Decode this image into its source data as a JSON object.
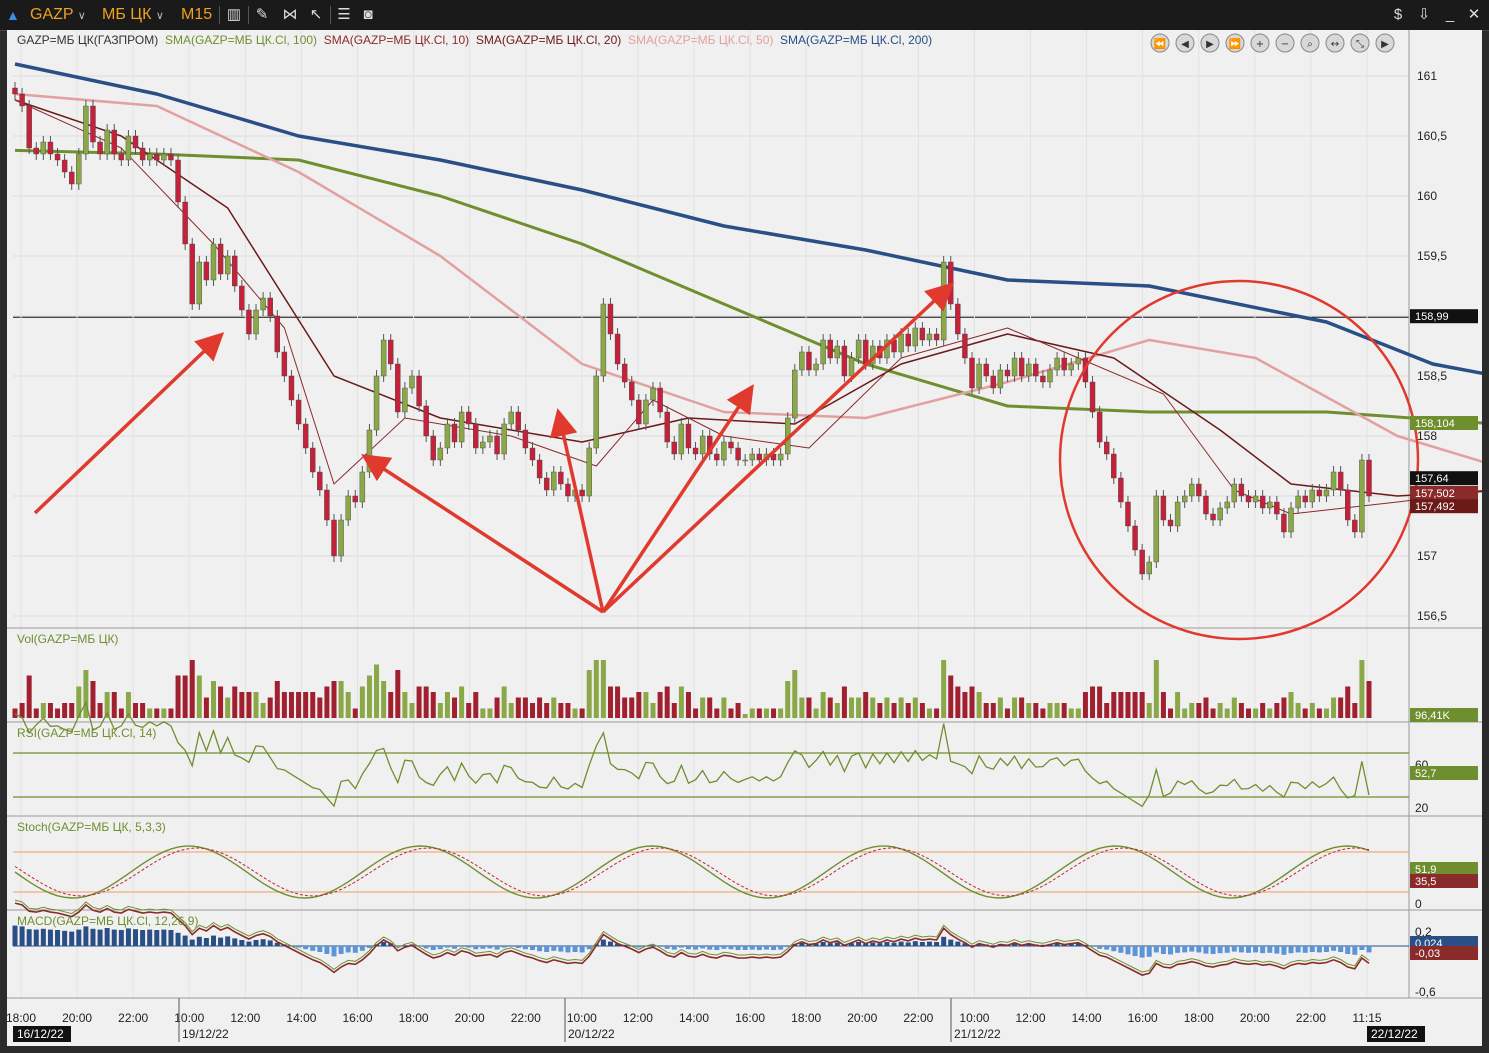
{
  "toolbar": {
    "symbol": "GAZP",
    "board": "МБ ЦК",
    "timeframe": "M15"
  },
  "panes": {
    "price": {
      "legend": [
        {
          "text": "GAZP=МБ ЦК(ГАЗПРОМ)",
          "color": "#333333"
        },
        {
          "text": "SMA(GAZP=МБ ЦК.Cl, 100)",
          "color": "#6f8f2f"
        },
        {
          "text": "SMA(GAZP=МБ ЦК.Cl, 10)",
          "color": "#8b2a2a"
        },
        {
          "text": "SMA(GAZP=МБ ЦК.Cl, 20)",
          "color": "#6b1a1a"
        },
        {
          "text": "SMA(GAZP=МБ ЦК.Cl, 50)",
          "color": "#e3a0a0"
        },
        {
          "text": "SMA(GAZP=МБ ЦК.Cl, 200)",
          "color": "#2a4f86"
        }
      ],
      "y_ticks": [
        "161",
        "160,5",
        "160",
        "159,5",
        "159",
        "158,5",
        "158",
        "157,5",
        "157",
        "156,5"
      ],
      "price_labels": [
        {
          "text": "158,99",
          "bg": "#111111"
        },
        {
          "text": "158,104",
          "bg": "#6f8f2f"
        },
        {
          "text": "157,64",
          "bg": "#111111"
        },
        {
          "text": "157,502",
          "bg": "#8b2a2a"
        },
        {
          "text": "157,492",
          "bg": "#6b1a1a"
        }
      ]
    },
    "volume": {
      "legend": "Vol(GAZP=МБ ЦК)",
      "value_label": "96,41K"
    },
    "rsi": {
      "legend": "RSI(GAZP=МБ ЦК.Cl, 14)",
      "ticks": [
        "60",
        "20"
      ],
      "value_label": "52,7"
    },
    "stoch": {
      "legend": "Stoch(GAZP=МБ ЦК, 5,3,3)",
      "ticks": [
        "0"
      ],
      "value_labels": [
        "51,9",
        "35,5"
      ]
    },
    "macd": {
      "legend": "MACD(GAZP=МБ ЦК.Cl, 12,26,9)",
      "ticks": [
        "0,2",
        "-0,6"
      ],
      "value_labels": [
        "0,024",
        "-0,03"
      ]
    }
  },
  "time_axis": {
    "labels": [
      "18:00",
      "20:00",
      "22:00",
      "10:00",
      "12:00",
      "14:00",
      "16:00",
      "18:00",
      "20:00",
      "22:00",
      "10:00",
      "12:00",
      "14:00",
      "16:00",
      "18:00",
      "20:00",
      "22:00",
      "10:00",
      "12:00",
      "14:00",
      "16:00",
      "18:00",
      "20:00",
      "22:00",
      "11:15"
    ],
    "dates": [
      "16/12/22",
      "19/12/22",
      "20/12/22",
      "21/12/22",
      "22/12/22"
    ]
  },
  "chart_data": {
    "type": "candlestick",
    "symbol": "GAZP",
    "timeframe": "M15",
    "ylim": [
      156.4,
      161.3
    ],
    "grid": true,
    "legend_position": "top-left",
    "candles": [
      [
        160.9,
        160.85
      ],
      [
        160.85,
        160.75
      ],
      [
        160.75,
        160.4
      ],
      [
        160.4,
        160.35
      ],
      [
        160.35,
        160.45
      ],
      [
        160.45,
        160.35
      ],
      [
        160.35,
        160.3
      ],
      [
        160.3,
        160.2
      ],
      [
        160.2,
        160.1
      ],
      [
        160.1,
        160.35
      ],
      [
        160.35,
        160.75
      ],
      [
        160.75,
        160.45
      ],
      [
        160.45,
        160.35
      ],
      [
        160.35,
        160.55
      ],
      [
        160.55,
        160.35
      ],
      [
        160.35,
        160.3
      ],
      [
        160.3,
        160.5
      ],
      [
        160.5,
        160.4
      ],
      [
        160.4,
        160.3
      ],
      [
        160.3,
        160.35
      ],
      [
        160.35,
        160.3
      ],
      [
        160.3,
        160.35
      ],
      [
        160.35,
        160.3
      ],
      [
        160.3,
        159.95
      ],
      [
        159.95,
        159.6
      ],
      [
        159.6,
        159.1
      ],
      [
        159.1,
        159.45
      ],
      [
        159.45,
        159.3
      ],
      [
        159.3,
        159.6
      ],
      [
        159.6,
        159.35
      ],
      [
        159.35,
        159.5
      ],
      [
        159.5,
        159.25
      ],
      [
        159.25,
        159.05
      ],
      [
        159.05,
        158.85
      ],
      [
        158.85,
        159.05
      ],
      [
        159.05,
        159.15
      ],
      [
        159.15,
        159.0
      ],
      [
        159.0,
        158.7
      ],
      [
        158.7,
        158.5
      ],
      [
        158.5,
        158.3
      ],
      [
        158.3,
        158.1
      ],
      [
        158.1,
        157.9
      ],
      [
        157.9,
        157.7
      ],
      [
        157.7,
        157.55
      ],
      [
        157.55,
        157.3
      ],
      [
        157.3,
        157.0
      ],
      [
        157.0,
        157.3
      ],
      [
        157.3,
        157.5
      ],
      [
        157.5,
        157.45
      ],
      [
        157.45,
        157.7
      ],
      [
        157.7,
        158.05
      ],
      [
        158.05,
        158.5
      ],
      [
        158.5,
        158.8
      ],
      [
        158.8,
        158.6
      ],
      [
        158.6,
        158.2
      ],
      [
        158.2,
        158.4
      ],
      [
        158.4,
        158.5
      ],
      [
        158.5,
        158.25
      ],
      [
        158.25,
        158.0
      ],
      [
        158.0,
        157.8
      ],
      [
        157.8,
        157.9
      ],
      [
        157.9,
        158.1
      ],
      [
        158.1,
        157.95
      ],
      [
        157.95,
        158.2
      ],
      [
        158.2,
        158.1
      ],
      [
        158.1,
        157.9
      ],
      [
        157.9,
        157.95
      ],
      [
        157.95,
        158.0
      ],
      [
        158.0,
        157.85
      ],
      [
        157.85,
        158.1
      ],
      [
        158.1,
        158.2
      ],
      [
        158.2,
        158.05
      ],
      [
        158.05,
        157.9
      ],
      [
        157.9,
        157.8
      ],
      [
        157.8,
        157.65
      ],
      [
        157.65,
        157.55
      ],
      [
        157.55,
        157.7
      ],
      [
        157.7,
        157.6
      ],
      [
        157.6,
        157.5
      ],
      [
        157.5,
        157.55
      ],
      [
        157.55,
        157.5
      ],
      [
        157.5,
        157.9
      ],
      [
        157.9,
        158.5
      ],
      [
        158.5,
        159.1
      ],
      [
        159.1,
        158.85
      ],
      [
        158.85,
        158.6
      ],
      [
        158.6,
        158.45
      ],
      [
        158.45,
        158.3
      ],
      [
        158.3,
        158.1
      ],
      [
        158.1,
        158.3
      ],
      [
        158.3,
        158.4
      ],
      [
        158.4,
        158.2
      ],
      [
        158.2,
        157.95
      ],
      [
        157.95,
        157.85
      ],
      [
        157.85,
        158.1
      ],
      [
        158.1,
        157.9
      ],
      [
        157.9,
        157.85
      ],
      [
        157.85,
        158.0
      ],
      [
        158.0,
        157.85
      ],
      [
        157.85,
        157.8
      ],
      [
        157.8,
        157.95
      ],
      [
        157.95,
        157.9
      ],
      [
        157.9,
        157.8
      ],
      [
        157.8,
        157.8
      ],
      [
        157.8,
        157.85
      ],
      [
        157.85,
        157.8
      ],
      [
        157.8,
        157.85
      ],
      [
        157.85,
        157.8
      ],
      [
        157.8,
        157.85
      ],
      [
        157.85,
        158.15
      ],
      [
        158.15,
        158.55
      ],
      [
        158.55,
        158.7
      ],
      [
        158.7,
        158.55
      ],
      [
        158.55,
        158.6
      ],
      [
        158.6,
        158.8
      ],
      [
        158.8,
        158.65
      ],
      [
        158.65,
        158.75
      ],
      [
        158.75,
        158.5
      ],
      [
        158.5,
        158.65
      ],
      [
        158.65,
        158.8
      ],
      [
        158.8,
        158.6
      ],
      [
        158.6,
        158.75
      ],
      [
        158.75,
        158.65
      ],
      [
        158.65,
        158.8
      ],
      [
        158.8,
        158.7
      ],
      [
        158.7,
        158.85
      ],
      [
        158.85,
        158.75
      ],
      [
        158.75,
        158.9
      ],
      [
        158.9,
        158.8
      ],
      [
        158.8,
        158.85
      ],
      [
        158.85,
        158.8
      ],
      [
        158.8,
        159.45
      ],
      [
        159.45,
        159.1
      ],
      [
        159.1,
        158.85
      ],
      [
        158.85,
        158.65
      ],
      [
        158.65,
        158.4
      ],
      [
        158.4,
        158.6
      ],
      [
        158.6,
        158.5
      ],
      [
        158.5,
        158.4
      ],
      [
        158.4,
        158.55
      ],
      [
        158.55,
        158.5
      ],
      [
        158.5,
        158.65
      ],
      [
        158.65,
        158.5
      ],
      [
        158.5,
        158.6
      ],
      [
        158.6,
        158.5
      ],
      [
        158.5,
        158.45
      ],
      [
        158.45,
        158.55
      ],
      [
        158.55,
        158.65
      ],
      [
        158.65,
        158.55
      ],
      [
        158.55,
        158.6
      ],
      [
        158.6,
        158.65
      ],
      [
        158.65,
        158.45
      ],
      [
        158.45,
        158.2
      ],
      [
        158.2,
        157.95
      ],
      [
        157.95,
        157.85
      ],
      [
        157.85,
        157.65
      ],
      [
        157.65,
        157.45
      ],
      [
        157.45,
        157.25
      ],
      [
        157.25,
        157.05
      ],
      [
        157.05,
        156.85
      ],
      [
        156.85,
        156.95
      ],
      [
        156.95,
        157.5
      ],
      [
        157.5,
        157.3
      ],
      [
        157.3,
        157.25
      ],
      [
        157.25,
        157.45
      ],
      [
        157.45,
        157.5
      ],
      [
        157.5,
        157.6
      ],
      [
        157.6,
        157.5
      ],
      [
        157.5,
        157.35
      ],
      [
        157.35,
        157.3
      ],
      [
        157.3,
        157.4
      ],
      [
        157.4,
        157.45
      ],
      [
        157.45,
        157.6
      ],
      [
        157.6,
        157.5
      ],
      [
        157.5,
        157.45
      ],
      [
        157.45,
        157.5
      ],
      [
        157.5,
        157.4
      ],
      [
        157.4,
        157.45
      ],
      [
        157.45,
        157.35
      ],
      [
        157.35,
        157.2
      ],
      [
        157.2,
        157.4
      ],
      [
        157.4,
        157.5
      ],
      [
        157.5,
        157.45
      ],
      [
        157.45,
        157.55
      ],
      [
        157.55,
        157.5
      ],
      [
        157.5,
        157.55
      ],
      [
        157.55,
        157.7
      ],
      [
        157.7,
        157.55
      ],
      [
        157.55,
        157.3
      ],
      [
        157.3,
        157.2
      ],
      [
        157.2,
        157.8
      ],
      [
        157.8,
        157.5
      ]
    ],
    "sma": [
      {
        "period": 200,
        "color": "#2a4f86",
        "values": [
          [
            0,
            161.1
          ],
          [
            20,
            160.85
          ],
          [
            40,
            160.5
          ],
          [
            60,
            160.3
          ],
          [
            80,
            160.05
          ],
          [
            100,
            159.75
          ],
          [
            120,
            159.55
          ],
          [
            140,
            159.3
          ],
          [
            160,
            159.25
          ],
          [
            185,
            158.95
          ],
          [
            200,
            158.6
          ],
          [
            209,
            158.5
          ]
        ]
      },
      {
        "period": 100,
        "color": "#6f8f2f",
        "values": [
          [
            0,
            160.38
          ],
          [
            20,
            160.35
          ],
          [
            40,
            160.3
          ],
          [
            60,
            160.0
          ],
          [
            80,
            159.6
          ],
          [
            100,
            159.1
          ],
          [
            120,
            158.6
          ],
          [
            140,
            158.25
          ],
          [
            160,
            158.2
          ],
          [
            185,
            158.2
          ],
          [
            209,
            158.1
          ]
        ]
      },
      {
        "period": 50,
        "color": "#e3a0a0",
        "values": [
          [
            0,
            160.85
          ],
          [
            20,
            160.75
          ],
          [
            40,
            160.2
          ],
          [
            60,
            159.5
          ],
          [
            80,
            158.6
          ],
          [
            100,
            158.2
          ],
          [
            120,
            158.15
          ],
          [
            140,
            158.45
          ],
          [
            160,
            158.8
          ],
          [
            175,
            158.65
          ],
          [
            195,
            158.0
          ],
          [
            209,
            157.75
          ]
        ]
      },
      {
        "period": 20,
        "color": "#6b1a1a",
        "values": [
          [
            0,
            160.8
          ],
          [
            15,
            160.5
          ],
          [
            30,
            159.9
          ],
          [
            45,
            158.5
          ],
          [
            60,
            158.15
          ],
          [
            80,
            157.95
          ],
          [
            95,
            158.15
          ],
          [
            110,
            158.1
          ],
          [
            125,
            158.6
          ],
          [
            140,
            158.85
          ],
          [
            155,
            158.65
          ],
          [
            170,
            158.05
          ],
          [
            180,
            157.6
          ],
          [
            195,
            157.5
          ],
          [
            209,
            157.55
          ]
        ]
      },
      {
        "period": 10,
        "color": "#8b2a2a",
        "values": [
          [
            0,
            160.8
          ],
          [
            15,
            160.4
          ],
          [
            28,
            159.6
          ],
          [
            38,
            158.9
          ],
          [
            45,
            157.6
          ],
          [
            55,
            158.15
          ],
          [
            70,
            158.0
          ],
          [
            82,
            157.75
          ],
          [
            90,
            158.3
          ],
          [
            100,
            158.0
          ],
          [
            112,
            157.9
          ],
          [
            125,
            158.65
          ],
          [
            140,
            158.9
          ],
          [
            150,
            158.65
          ],
          [
            162,
            158.35
          ],
          [
            172,
            157.55
          ],
          [
            180,
            157.35
          ],
          [
            195,
            157.45
          ],
          [
            209,
            157.55
          ]
        ]
      }
    ],
    "annotations": [
      "arrows-to-sma-touches",
      "circle-recent-range"
    ],
    "volume_ylim": [
      0,
      1
    ]
  }
}
